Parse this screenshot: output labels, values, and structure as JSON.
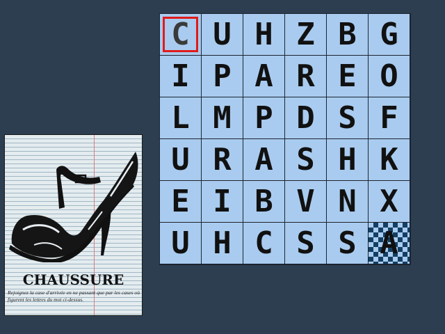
{
  "card": {
    "title": "CHAUSSURE",
    "instructions": "Rejoignez la case d'arrivée en ne passant que par les cases où figurent les lettres du mot ci-dessus.",
    "illustration_icon": "high-heel-shoe-icon"
  },
  "grid": {
    "rows": [
      [
        "C",
        "U",
        "H",
        "Z",
        "B",
        "G"
      ],
      [
        "I",
        "P",
        "A",
        "R",
        "E",
        "O"
      ],
      [
        "L",
        "M",
        "P",
        "D",
        "S",
        "F"
      ],
      [
        "U",
        "R",
        "A",
        "S",
        "H",
        "K"
      ],
      [
        "E",
        "I",
        "B",
        "V",
        "N",
        "X"
      ],
      [
        "U",
        "H",
        "C",
        "S",
        "S",
        "A"
      ]
    ],
    "start_cell": [
      0,
      0
    ],
    "finish_cell": [
      5,
      5
    ],
    "colors": {
      "cell": "#a9cbef",
      "start_border": "#e01b1b",
      "finish_checker": "#123f63",
      "background": "#2c3e50"
    }
  }
}
